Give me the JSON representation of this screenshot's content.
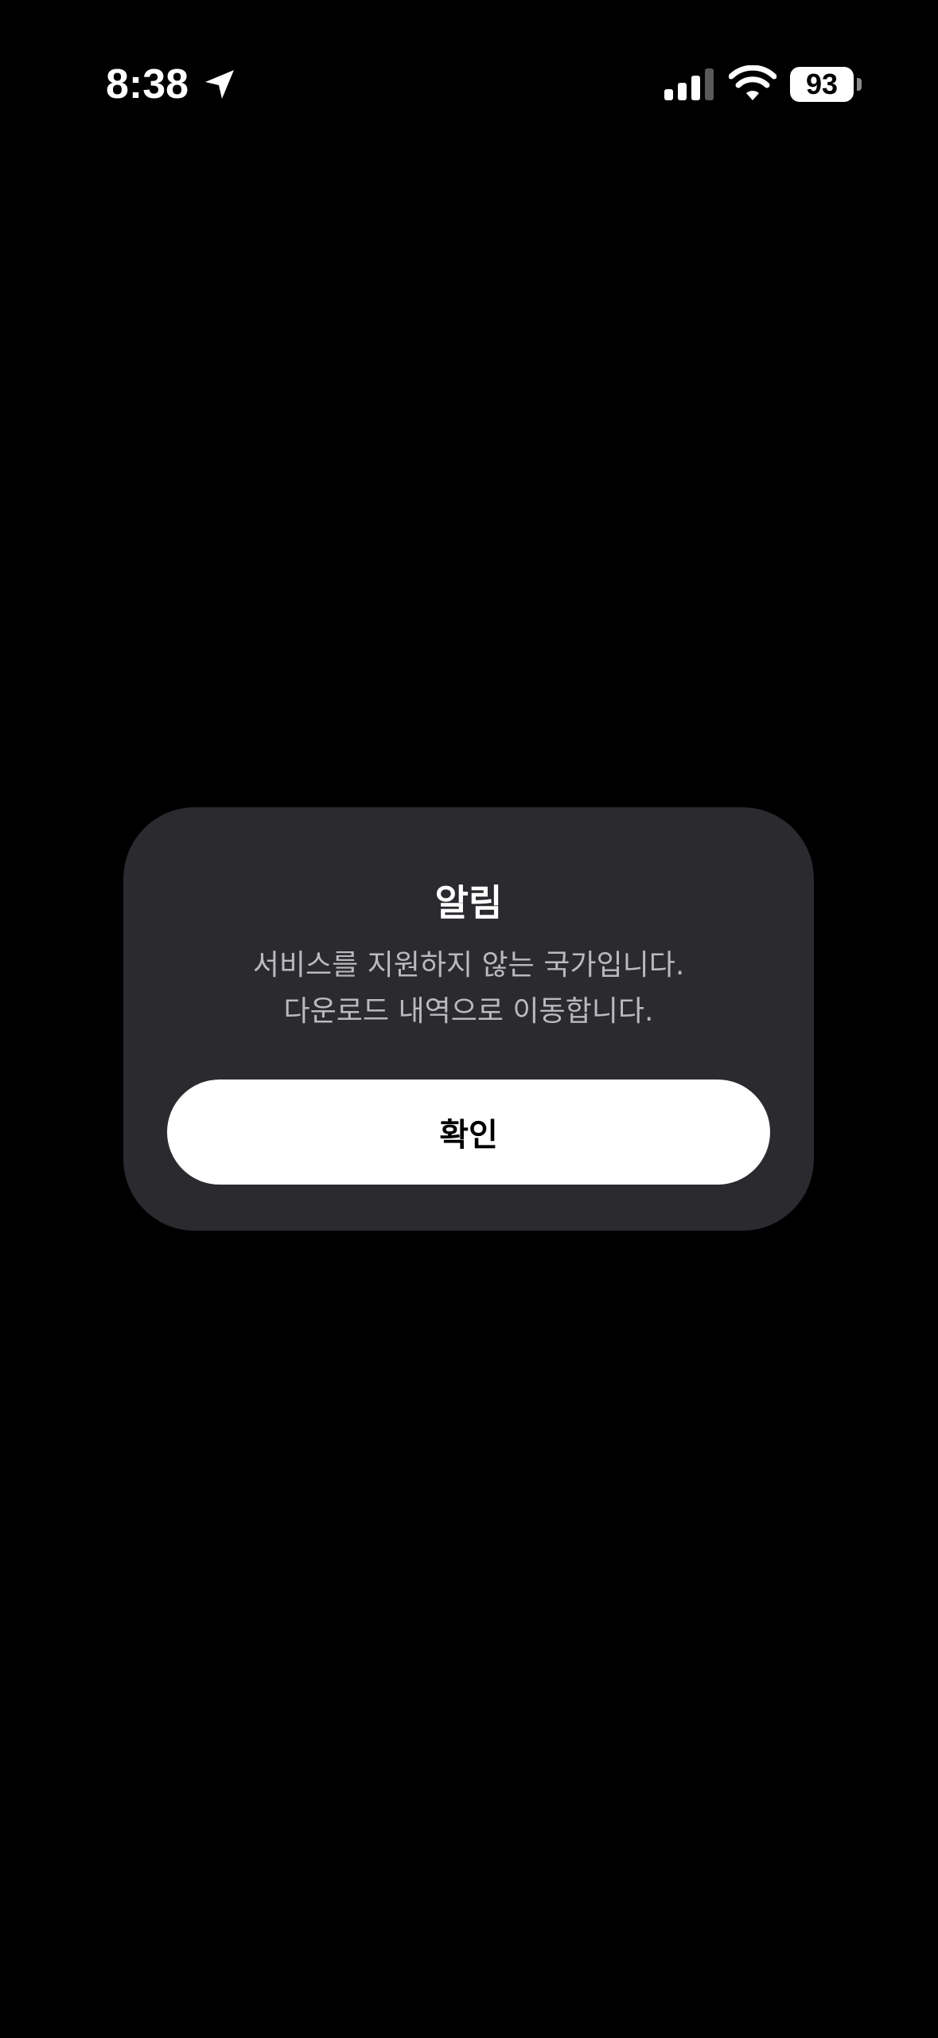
{
  "status_bar": {
    "time": "8:38",
    "battery_level": "93",
    "icons": {
      "location": "location-arrow-icon",
      "signal": "cellular-signal-icon",
      "wifi": "wifi-icon",
      "battery": "battery-icon"
    }
  },
  "alert": {
    "title": "알림",
    "message_line1": "서비스를 지원하지 않는 국가입니다.",
    "message_line2": "다운로드 내역으로 이동합니다.",
    "confirm_label": "확인"
  },
  "colors": {
    "background": "#000000",
    "dialog_background": "#2a2a2f",
    "message_text": "#b9b9bf",
    "button_background": "#ffffff",
    "button_text": "#000000"
  }
}
